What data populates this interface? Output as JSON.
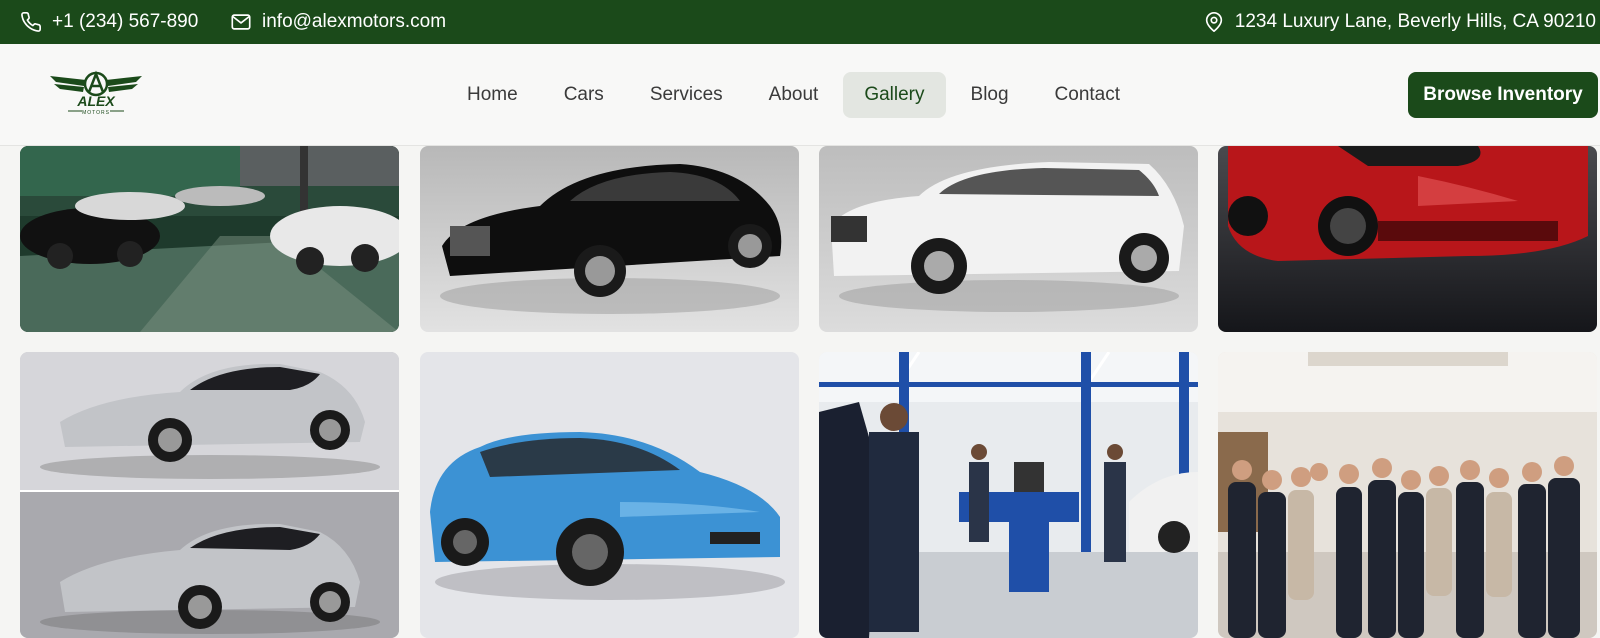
{
  "topbar": {
    "phone": "+1 (234) 567-890",
    "email": "info@alexmotors.com",
    "address": "1234 Luxury Lane, Beverly Hills, CA 90210",
    "phone_icon": "phone-icon",
    "email_icon": "mail-icon",
    "address_icon": "map-pin-icon"
  },
  "brand": {
    "logo_line1": "ALEX",
    "logo_line2": "MOTORS",
    "color": "#1b4a1a"
  },
  "nav": {
    "items": [
      {
        "label": "Home"
      },
      {
        "label": "Cars"
      },
      {
        "label": "Services"
      },
      {
        "label": "About"
      },
      {
        "label": "Gallery",
        "active": true
      },
      {
        "label": "Blog"
      },
      {
        "label": "Contact"
      }
    ],
    "cta": "Browse Inventory"
  },
  "gallery": {
    "images": [
      "showroom-interior",
      "black-luxury-sedan",
      "white-suv",
      "red-sports-car",
      "silver-convertible",
      "blue-electric-hatchback",
      "service-workshop",
      "staff-team-photo"
    ]
  }
}
